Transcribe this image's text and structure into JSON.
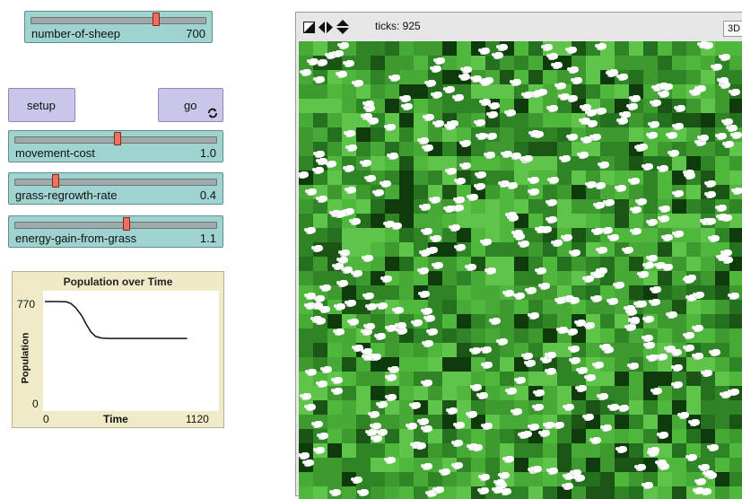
{
  "sliders": [
    {
      "name": "number-of-sheep",
      "value": "700",
      "fraction": 0.7
    },
    {
      "name": "movement-cost",
      "value": "1.0",
      "fraction": 0.5
    },
    {
      "name": "grass-regrowth-rate",
      "value": "0.4",
      "fraction": 0.2
    },
    {
      "name": "energy-gain-from-grass",
      "value": "1.1",
      "fraction": 0.55
    }
  ],
  "buttons": {
    "setup": "setup",
    "go": "go",
    "go_icon": "forever-icon"
  },
  "plot": {
    "title": "Population over Time",
    "ylabel": "Population",
    "xlabel": "Time",
    "ymax_label": "770",
    "ymin_label": "0",
    "xmin_label": "0",
    "xmax_label": "1120"
  },
  "chart_data": {
    "type": "line",
    "title": "Population over Time",
    "xlabel": "Time",
    "ylabel": "Population",
    "xlim": [
      0,
      1120
    ],
    "ylim": [
      0,
      770
    ],
    "grid": false,
    "series": [
      {
        "x": [
          0,
          80,
          140,
          170,
          200,
          240,
          270,
          300,
          330,
          370,
          420,
          500,
          600,
          700,
          800,
          925
        ],
        "y": [
          770,
          770,
          768,
          755,
          725,
          665,
          600,
          545,
          512,
          500,
          497,
          497,
          497,
          497,
          497,
          497
        ]
      }
    ]
  },
  "view": {
    "ticks_text": "ticks: 925",
    "view3d_label": "3D",
    "toolbar_icons": [
      "edit-shapes-icon",
      "horizontal-arrows-icon",
      "vertical-arrows-icon"
    ]
  },
  "colors": {
    "slider": "#9ed3cf",
    "button": "#c9c6ea",
    "plot_bg": "#efebc8",
    "sheep": "#ffffff",
    "grass": "#3a9a2b"
  }
}
